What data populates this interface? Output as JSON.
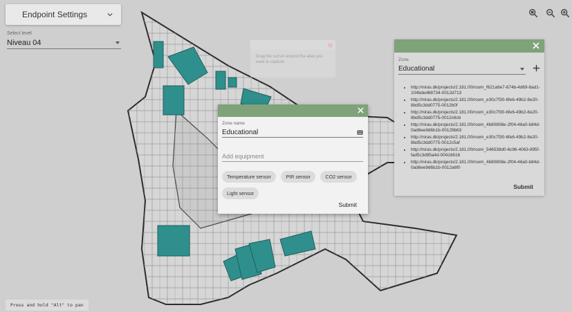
{
  "left_panel": {
    "endpoint_button_label": "Endpoint Settings",
    "level_label": "Select level",
    "level_value": "Niveau 04"
  },
  "hint_text": "Press and hold \"Alt\" to pan",
  "zoom_controls": [
    "zoom-reset-icon",
    "zoom-out-icon",
    "zoom-in-icon"
  ],
  "ghost_tooltip": {
    "text": "Drag the cursor around the area you want to capture"
  },
  "zone_panel": {
    "zone_label": "Zone",
    "zone_value": "Educational",
    "rooms": [
      "http://niras.dk/projects/2.181.00/room_f621a9e7-674b-4d69-8ad1-104bded68734-0012d713",
      "http://niras.dk/projects/2.181.00/room_e30c7f30-6fe6-49b2-8e20-8bd5c3dd0775-0012b0f",
      "http://niras.dk/projects/2.181.00/room_e30c7f30-6fe6-49b2-8e20-8bd5c3dd0775-0012c6cb",
      "http://niras.dk/projects/2.181.00/room_4b80808e-2f04-46a0-b84d-0ad6ee9d6b1b-00129b63",
      "http://niras.dk/projects/2.181.00/room_e30c7f30-6fe6-49b2-8e20-8bd5c3dd0775-0012c5af",
      "http://niras.dk/projects/2.181.00/room_546538d0-6c96-4063-895f-fad5c3d95a4d-00416616",
      "http://niras.dk/projects/2.181.00/room_4b80808e-2f04-46a0-b84d-0ad6ee9d6b1b-0012a6f0"
    ],
    "submit_label": "Submit"
  },
  "modal": {
    "zone_name_label": "Zone name",
    "zone_name_value": "Educational",
    "add_equipment_placeholder": "Add equipment",
    "chips": [
      "Temperature sensor",
      "PIR sensor",
      "CO2 sensor",
      "Light sensor"
    ],
    "submit_label": "Submit"
  },
  "colors": {
    "header_green": "#7fa27a",
    "room_teal": "#2f8f8c",
    "background": "#cfcfcf"
  }
}
